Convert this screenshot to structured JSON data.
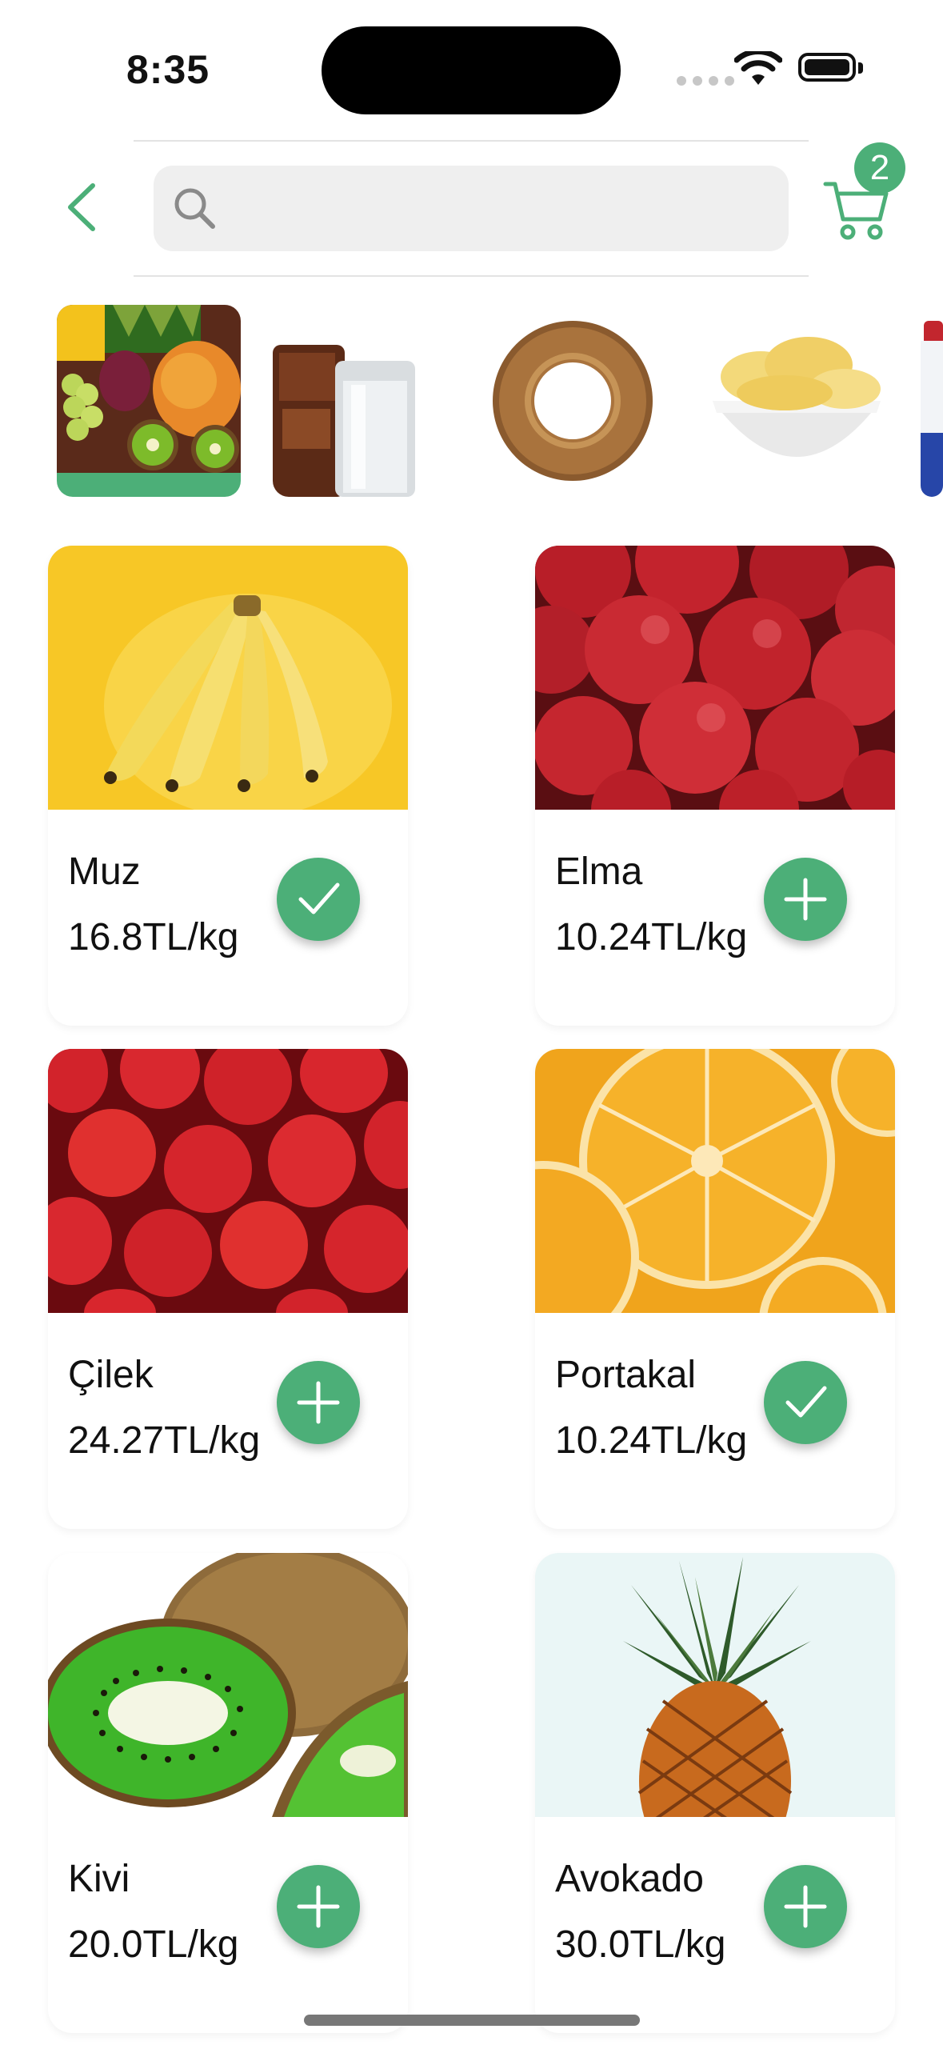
{
  "status": {
    "time": "8:35"
  },
  "header": {
    "search_placeholder": "",
    "cart_count": "2"
  },
  "categories": [
    {
      "name": "meyve-sebze",
      "selected": true
    },
    {
      "name": "icecekler",
      "selected": false
    },
    {
      "name": "firin",
      "selected": false
    },
    {
      "name": "atistirmalik",
      "selected": false
    },
    {
      "name": "sut-urunleri",
      "selected": false
    }
  ],
  "products": [
    {
      "name": "Muz",
      "price": "16.8TL/kg",
      "in_cart": true
    },
    {
      "name": "Elma",
      "price": "10.24TL/kg",
      "in_cart": false
    },
    {
      "name": "Çilek",
      "price": "24.27TL/kg",
      "in_cart": false
    },
    {
      "name": "Portakal",
      "price": "10.24TL/kg",
      "in_cart": true
    },
    {
      "name": "Kivi",
      "price": "20.0TL/kg",
      "in_cart": false
    },
    {
      "name": "Avokado",
      "price": "30.0TL/kg",
      "in_cart": false
    }
  ],
  "colors": {
    "accent": "#4caf78",
    "search_bg": "#efefef"
  },
  "icons": {
    "back": "chevron-left-icon",
    "search": "search-icon",
    "cart": "cart-icon",
    "check": "check-icon",
    "plus": "plus-icon"
  }
}
